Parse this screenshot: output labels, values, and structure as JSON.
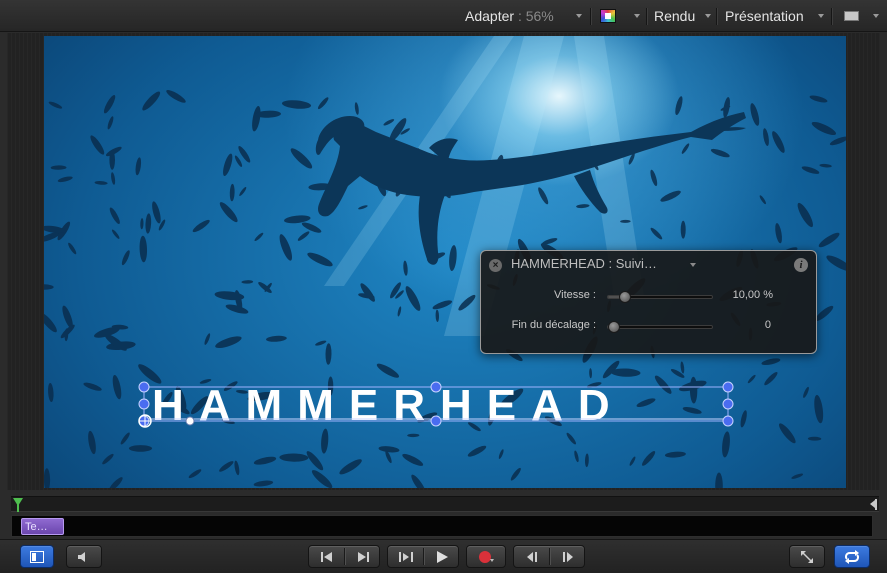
{
  "toolbar": {
    "fit_label": "Adapter",
    "zoom_value": ": 56%",
    "render_label": "Rendu",
    "presentation_label": "Présentation"
  },
  "canvas": {
    "title_text": "HAMMERHEAD"
  },
  "hud": {
    "title": "HAMMERHEAD : Suivi…",
    "rows": [
      {
        "label": "Vitesse :",
        "value": "10,00 %",
        "slider_fraction": 0.12
      },
      {
        "label": "Fin du décalage :",
        "value": "0",
        "slider_fraction": 0.0
      }
    ]
  },
  "timeline": {
    "clip_label": "Te…"
  },
  "colors": {
    "accent_blue": "#2f6fd6",
    "clip_purple": "#7a55bf",
    "playhead_green": "#4fbe4f",
    "record_red": "#d9313a",
    "handle_blue": "#4a6cf0"
  },
  "icons": {
    "toolbar": [
      "color-channels-icon",
      "view-layout-icon"
    ],
    "transport": [
      "toggle-inspector-icon",
      "audio-icon",
      "go-to-start-icon",
      "go-to-end-icon",
      "play-range-icon",
      "play-icon",
      "record-icon",
      "previous-frame-icon",
      "next-frame-icon",
      "fullscreen-icon",
      "loop-icon"
    ]
  }
}
